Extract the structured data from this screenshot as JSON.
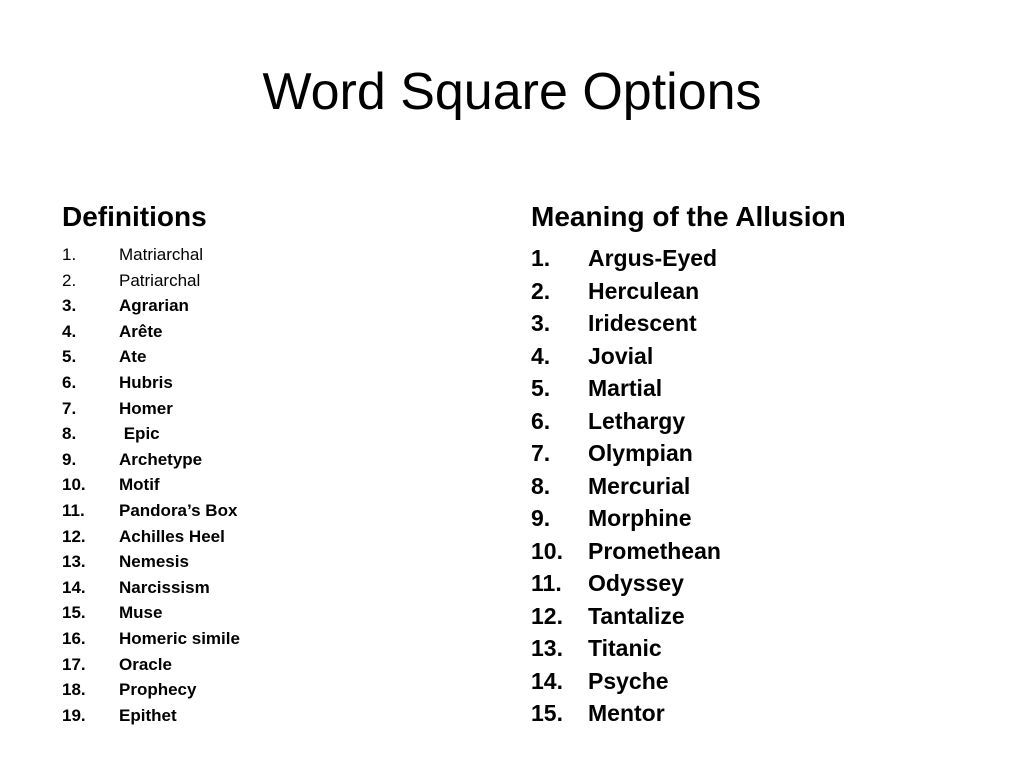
{
  "title": "Word Square Options",
  "definitions": {
    "heading": "Definitions",
    "items": [
      {
        "num": "1.",
        "text": "Matriarchal",
        "bold": false
      },
      {
        "num": "2.",
        "text": "Patriarchal",
        "bold": false
      },
      {
        "num": "3.",
        "text": "Agrarian",
        "bold": true
      },
      {
        "num": "4.",
        "text": "Arête",
        "bold": true
      },
      {
        "num": "5.",
        "text": "Ate",
        "bold": true
      },
      {
        "num": "6.",
        "text": "Hubris",
        "bold": true
      },
      {
        "num": "7.",
        "text": "Homer",
        "bold": true
      },
      {
        "num": "8.",
        "text": " Epic",
        "bold": true
      },
      {
        "num": "9.",
        "text": "Archetype",
        "bold": true
      },
      {
        "num": "10.",
        "text": "Motif",
        "bold": true
      },
      {
        "num": "11.",
        "text": "Pandora’s Box",
        "bold": true
      },
      {
        "num": "12.",
        "text": "Achilles Heel",
        "bold": true
      },
      {
        "num": "13.",
        "text": "Nemesis",
        "bold": true
      },
      {
        "num": "14.",
        "text": "Narcissism",
        "bold": true
      },
      {
        "num": "15.",
        "text": "Muse",
        "bold": true
      },
      {
        "num": "16.",
        "text": "Homeric simile",
        "bold": true
      },
      {
        "num": "17.",
        "text": "Oracle",
        "bold": true
      },
      {
        "num": "18.",
        "text": "Prophecy",
        "bold": true
      },
      {
        "num": "19.",
        "text": "Epithet",
        "bold": true
      }
    ]
  },
  "allusions": {
    "heading": "Meaning of the Allusion",
    "items": [
      {
        "num": "1.",
        "text": "Argus-Eyed"
      },
      {
        "num": "2.",
        "text": "Herculean"
      },
      {
        "num": "3.",
        "text": "Iridescent"
      },
      {
        "num": "4.",
        "text": "Jovial"
      },
      {
        "num": "5.",
        "text": "Martial"
      },
      {
        "num": "6.",
        "text": "Lethargy"
      },
      {
        "num": "7.",
        "text": "Olympian"
      },
      {
        "num": "8.",
        "text": "Mercurial"
      },
      {
        "num": "9.",
        "text": "Morphine"
      },
      {
        "num": "10.",
        "text": "Promethean"
      },
      {
        "num": "11.",
        "text": "Odyssey"
      },
      {
        "num": "12.",
        "text": "Tantalize"
      },
      {
        "num": "13.",
        "text": "Titanic"
      },
      {
        "num": "14.",
        "text": "Psyche"
      },
      {
        "num": "15.",
        "text": "Mentor"
      }
    ]
  }
}
